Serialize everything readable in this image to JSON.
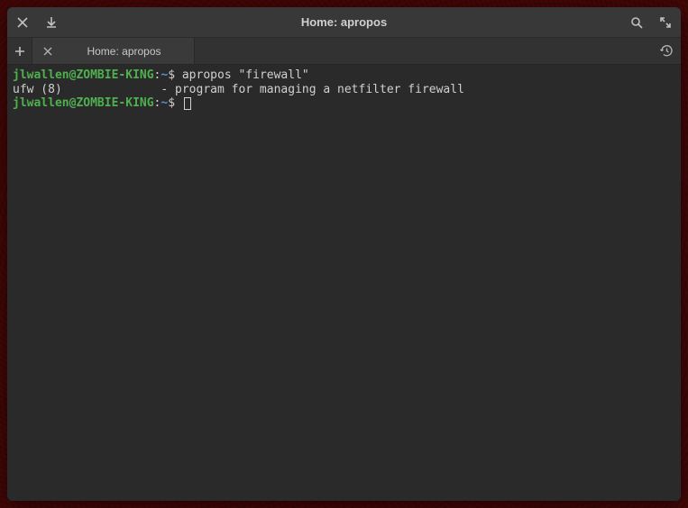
{
  "window": {
    "title": "Home: apropos"
  },
  "tabs": [
    {
      "label": "Home: apropos"
    }
  ],
  "terminal": {
    "prompt": {
      "user": "jlwallen",
      "host": "ZOMBIE-KING",
      "path": "~",
      "symbol": "$"
    },
    "lines": [
      {
        "type": "prompt",
        "command": "apropos \"firewall\""
      },
      {
        "type": "output",
        "text": "ufw (8)              - program for managing a netfilter firewall"
      },
      {
        "type": "prompt",
        "command": "",
        "cursor": true
      }
    ]
  },
  "icons": {
    "close": "close-icon",
    "download": "download-icon",
    "search": "search-icon",
    "maximize": "maximize-icon",
    "plus": "plus-icon",
    "tab_close": "tab-close-icon",
    "history": "history-icon"
  }
}
